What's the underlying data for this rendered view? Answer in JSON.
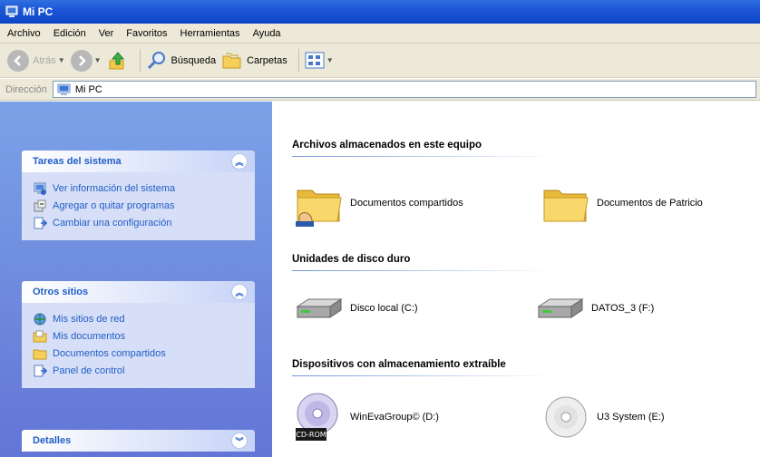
{
  "window": {
    "title": "Mi PC"
  },
  "menu": {
    "items": [
      "Archivo",
      "Edición",
      "Ver",
      "Favoritos",
      "Herramientas",
      "Ayuda"
    ]
  },
  "toolbar": {
    "back_label": "Atrás",
    "search_label": "Búsqueda",
    "folders_label": "Carpetas"
  },
  "address": {
    "label": "Dirección",
    "value": "Mi PC"
  },
  "left": {
    "system_tasks": {
      "title": "Tareas del sistema",
      "items": [
        {
          "label": "Ver información del sistema",
          "icon": "system-info-icon"
        },
        {
          "label": "Agregar o quitar programas",
          "icon": "add-remove-programs-icon"
        },
        {
          "label": "Cambiar una configuración",
          "icon": "control-panel-icon"
        }
      ]
    },
    "other_places": {
      "title": "Otros sitios",
      "items": [
        {
          "label": "Mis sitios de red",
          "icon": "network-places-icon"
        },
        {
          "label": "Mis documentos",
          "icon": "my-documents-icon"
        },
        {
          "label": "Documentos compartidos",
          "icon": "shared-folder-icon"
        },
        {
          "label": "Panel de control",
          "icon": "control-panel-icon"
        }
      ]
    },
    "details": {
      "title": "Detalles"
    }
  },
  "main": {
    "sections": [
      {
        "title": "Archivos almacenados en este equipo",
        "items": [
          {
            "label": "Documentos compartidos",
            "icon": "folder-shared-icon"
          },
          {
            "label": "Documentos de Patricio",
            "icon": "folder-icon"
          }
        ]
      },
      {
        "title": "Unidades de disco duro",
        "items": [
          {
            "label": "Disco local (C:)",
            "icon": "hard-drive-icon"
          },
          {
            "label": "DATOS_3 (F:)",
            "icon": "hard-drive-icon"
          }
        ]
      },
      {
        "title": "Dispositivos con almacenamiento extraíble",
        "items": [
          {
            "label": "WinEvaGroup© (D:)",
            "icon": "cd-rom-icon",
            "badge": "CD-ROM"
          },
          {
            "label": "U3 System (E:)",
            "icon": "cd-drive-icon"
          }
        ]
      }
    ]
  }
}
